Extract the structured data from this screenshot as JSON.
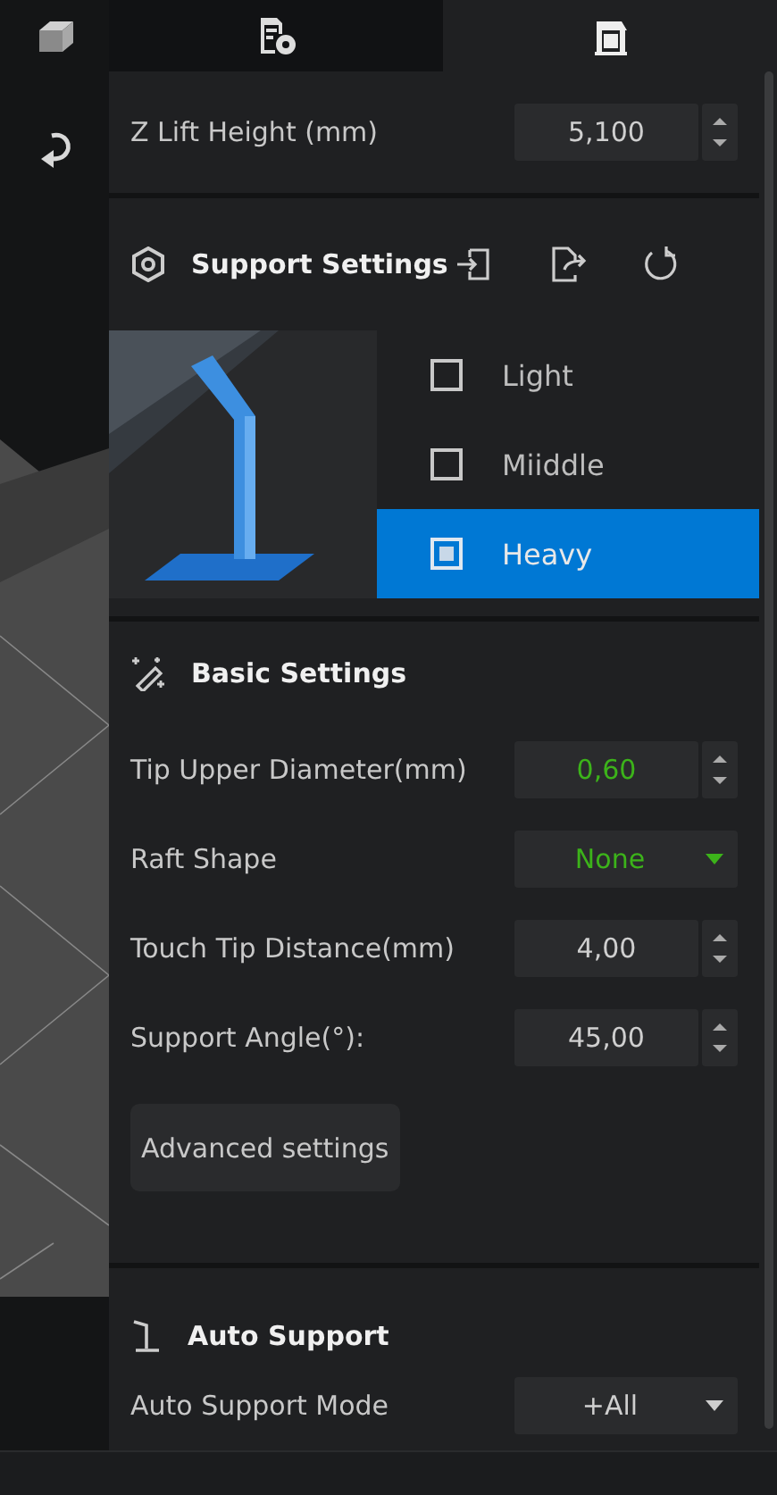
{
  "tabs": [
    {
      "selected": false
    },
    {
      "selected": true
    }
  ],
  "z_lift": {
    "label": "Z Lift Height (mm)",
    "value": "5,100"
  },
  "support_settings": {
    "title": "Support Settings",
    "options": [
      {
        "label": "Light",
        "selected": false
      },
      {
        "label": "Miiddle",
        "selected": false
      },
      {
        "label": "Heavy",
        "selected": true
      }
    ]
  },
  "basic_settings": {
    "title": "Basic Settings",
    "rows": [
      {
        "kind": "spin",
        "label": "Tip Upper Diameter(mm)",
        "value": "0,60",
        "highlighted": true
      },
      {
        "kind": "select",
        "label": "Raft Shape",
        "value": "None",
        "highlighted": true
      },
      {
        "kind": "spin",
        "label": "Touch Tip Distance(mm)",
        "value": "4,00",
        "highlighted": false
      },
      {
        "kind": "spin",
        "label": "Support Angle(°):",
        "value": "45,00",
        "highlighted": false
      }
    ],
    "button": "Advanced settings"
  },
  "auto_support": {
    "title": "Auto Support",
    "rows": [
      {
        "kind": "select",
        "label": "Auto Support Mode",
        "value": "+All",
        "highlighted": false
      }
    ]
  }
}
